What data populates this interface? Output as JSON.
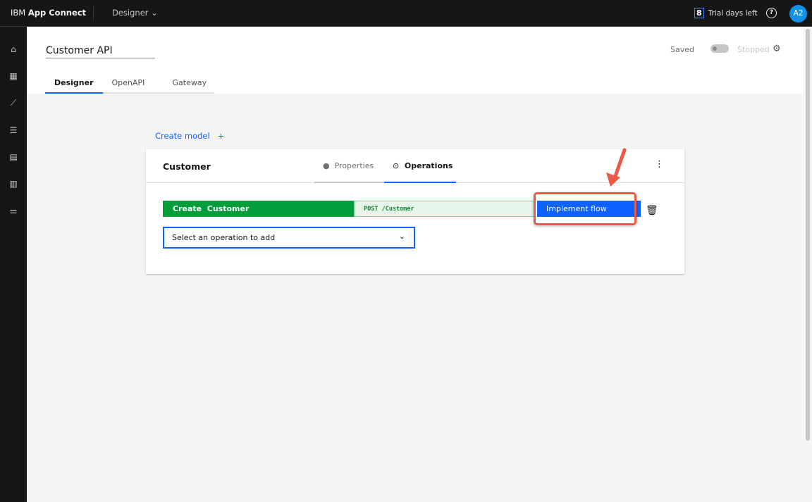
{
  "topbar": {
    "brand_prefix": "IBM",
    "brand_name": "App Connect",
    "switcher": "Designer",
    "trial_days": "8",
    "trial_text": "Trial days left",
    "avatar": "A2"
  },
  "sidebar": {
    "items": [
      "home-icon",
      "dashboard-icon",
      "chart-icon",
      "catalog-icon",
      "templates-icon",
      "clipboard-icon",
      "settings-sliders-icon"
    ]
  },
  "header": {
    "api_name": "Customer API",
    "save_status": "Saved",
    "run_status": "Stopped",
    "running": false,
    "tabs": [
      {
        "label": "Designer",
        "active": true
      },
      {
        "label": "OpenAPI"
      },
      {
        "label": "Gateway"
      }
    ]
  },
  "main": {
    "create_model": "Create model",
    "create_model_icon": "+",
    "model": {
      "title": "Customer",
      "tabs": [
        {
          "label": "Properties"
        },
        {
          "label": "Operations",
          "active": true
        }
      ],
      "operation": {
        "name": "Create  Customer",
        "method_path": "POST /Customer",
        "action": "Implement flow"
      },
      "select_placeholder": "Select an operation to add"
    }
  },
  "colors": {
    "accent": "#0f62fe",
    "operation_green": "#009d3a",
    "highlight": "#ea5a47"
  }
}
